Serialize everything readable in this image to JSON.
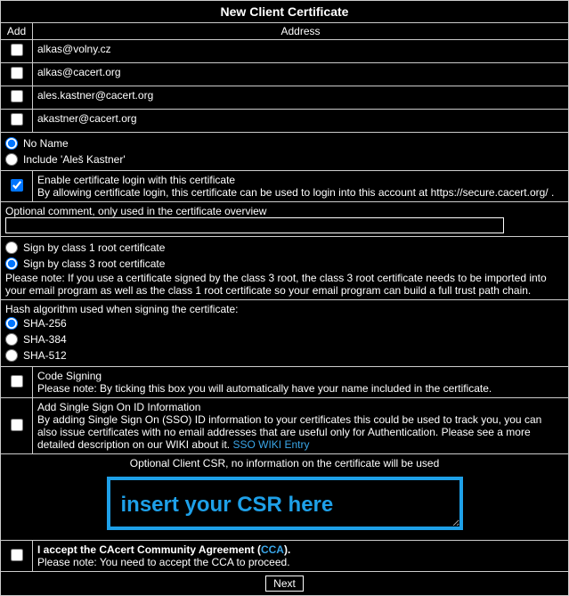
{
  "title": "New Client Certificate",
  "headers": {
    "add": "Add",
    "address": "Address"
  },
  "emails": [
    "alkas@volny.cz",
    "alkas@cacert.org",
    "ales.kastner@cacert.org",
    "akastner@cacert.org"
  ],
  "name_options": {
    "no_name": "No Name",
    "include": "Include 'Aleš Kastner'"
  },
  "enable_login": {
    "title": "Enable certificate login with this certificate",
    "note": "By allowing certificate login, this certificate can be used to login into this account at https://secure.cacert.org/ ."
  },
  "optional_comment_label": "Optional comment, only used in the certificate overview",
  "sign": {
    "class1": "Sign by class 1 root certificate",
    "class3": "Sign by class 3 root certificate",
    "note": "Please note: If you use a certificate signed by the class 3 root, the class 3 root certificate needs to be imported into your email program as well as the class 1 root certificate so your email program can build a full trust path chain."
  },
  "hash": {
    "label": "Hash algorithm used when signing the certificate:",
    "sha256": "SHA-256",
    "sha384": "SHA-384",
    "sha512": "SHA-512"
  },
  "code_signing": {
    "title": "Code Signing",
    "note": "Please note: By ticking this box you will automatically have your name included in the certificate."
  },
  "sso": {
    "title": "Add Single Sign On ID Information",
    "note": "By adding Single Sign On (SSO) ID information to your certificates this could be used to track you, you can also issue certificates with no email addresses that are useful only for Authentication. Please see a more detailed description on our WIKI about it. ",
    "link": "SSO WIKI Entry"
  },
  "csr": {
    "label": "Optional Client CSR, no information on the certificate will be used",
    "placeholder": "insert your CSR here"
  },
  "cca": {
    "prefix": "I accept the CAcert Community Agreement (",
    "link": "CCA",
    "suffix": ").",
    "note": "Please note: You need to accept the CCA to proceed."
  },
  "next": "Next"
}
